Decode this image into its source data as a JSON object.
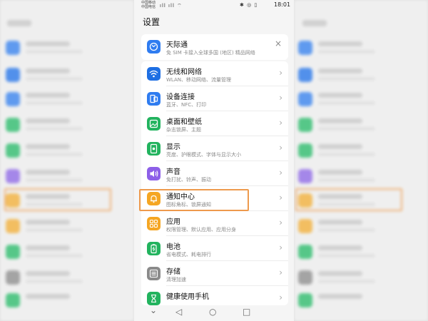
{
  "status_bar": {
    "carrier_1": "中国移动",
    "carrier_2": "中国电信",
    "signal_icons": "ıll ıll ⌔",
    "status_icons": "✱ ◎ ▯",
    "time": "18:01"
  },
  "page_title": "设置",
  "items": [
    {
      "title": "天际通",
      "subtitle": "免 SIM 卡接入全球多国 (地区) 精品网络",
      "color": "#2f7cf0",
      "icon": "globe-icon",
      "action": "×"
    },
    {
      "title": "无线和网络",
      "subtitle": "WLAN、移动网络、流量管理",
      "color": "#1e6fe3",
      "icon": "wifi-icon",
      "action": "›"
    },
    {
      "title": "设备连接",
      "subtitle": "蓝牙、NFC、打印",
      "color": "#2f7cf0",
      "icon": "device-connect-icon",
      "action": "›"
    },
    {
      "title": "桌面和壁纸",
      "subtitle": "杂志锁屏、主题",
      "color": "#22b35e",
      "icon": "wallpaper-icon",
      "action": "›"
    },
    {
      "title": "显示",
      "subtitle": "亮度、护眼模式、字体与显示大小",
      "color": "#22b35e",
      "icon": "display-icon",
      "action": "›"
    },
    {
      "title": "声音",
      "subtitle": "免打扰、铃声、振动",
      "color": "#8d5fe8",
      "icon": "sound-icon",
      "action": "›"
    },
    {
      "title": "通知中心",
      "subtitle": "图标角标、锁屏通知",
      "color": "#f5a623",
      "icon": "bell-icon",
      "action": "›"
    },
    {
      "title": "应用",
      "subtitle": "权限管理、默认应用、应用分身",
      "color": "#f5a623",
      "icon": "apps-icon",
      "action": "›"
    },
    {
      "title": "电池",
      "subtitle": "省电模式、耗电排行",
      "color": "#22b35e",
      "icon": "battery-icon",
      "action": "›"
    },
    {
      "title": "存储",
      "subtitle": "清理加速",
      "color": "#8a8a8a",
      "icon": "storage-icon",
      "action": "›"
    },
    {
      "title": "健康使用手机",
      "subtitle": "",
      "color": "#22b35e",
      "icon": "hourglass-icon",
      "action": "›"
    }
  ],
  "nav_bar": {
    "down": "⌄",
    "back": "◁",
    "home": "○",
    "recent": "□"
  },
  "highlight_color": "#ee9a4d"
}
